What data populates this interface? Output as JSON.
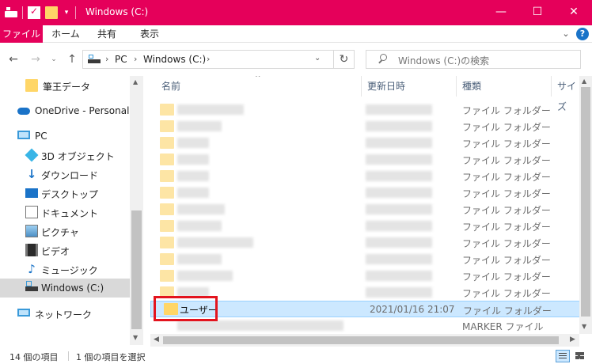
{
  "window": {
    "title": "Windows (C:)",
    "controls": {
      "minimize": "—",
      "maximize": "☐",
      "close": "✕"
    }
  },
  "ribbon": {
    "tabs": [
      "ファイル",
      "ホーム",
      "共有",
      "表示"
    ],
    "expand": "⌄",
    "help": "?"
  },
  "nav": {
    "back": "←",
    "forward": "→",
    "recent": "⌄",
    "up": "↑",
    "breadcrumb": [
      "PC",
      "Windows (C:)"
    ],
    "crumb_sep": "›",
    "address_dropdown": "⌄",
    "refresh": "↻",
    "search_placeholder": "Windows (C:)の検索"
  },
  "sidebar": {
    "items": [
      {
        "label": "筆王データ",
        "icon": "folder-icon"
      },
      {
        "label": "OneDrive - Personal",
        "icon": "cloud-icon"
      },
      {
        "label": "PC",
        "icon": "pc-icon"
      },
      {
        "label": "3D オブジェクト",
        "icon": "3d-objects-icon"
      },
      {
        "label": "ダウンロード",
        "icon": "download-icon"
      },
      {
        "label": "デスクトップ",
        "icon": "desktop-icon"
      },
      {
        "label": "ドキュメント",
        "icon": "document-icon"
      },
      {
        "label": "ピクチャ",
        "icon": "picture-icon"
      },
      {
        "label": "ビデオ",
        "icon": "video-icon"
      },
      {
        "label": "ミュージック",
        "icon": "music-icon"
      },
      {
        "label": "Windows (C:)",
        "icon": "drive-icon",
        "selected": true
      },
      {
        "label": "ネットワーク",
        "icon": "network-icon"
      }
    ]
  },
  "file_list": {
    "columns": [
      "名前",
      "更新日時",
      "種類",
      "サイズ"
    ],
    "sort_indicator": "^",
    "rows": [
      {
        "name": "",
        "date": "",
        "type": "ファイル フォルダー"
      },
      {
        "name": "",
        "date": "",
        "type": "ファイル フォルダー"
      },
      {
        "name": "",
        "date": "",
        "type": "ファイル フォルダー"
      },
      {
        "name": "",
        "date": "",
        "type": "ファイル フォルダー"
      },
      {
        "name": "",
        "date": "",
        "type": "ファイル フォルダー"
      },
      {
        "name": "",
        "date": "",
        "type": "ファイル フォルダー"
      },
      {
        "name": "",
        "date": "",
        "type": "ファイル フォルダー"
      },
      {
        "name": "",
        "date": "",
        "type": "ファイル フォルダー"
      },
      {
        "name": "",
        "date": "",
        "type": "ファイル フォルダー"
      },
      {
        "name": "",
        "date": "",
        "type": "ファイル フォルダー"
      },
      {
        "name": "",
        "date": "",
        "type": "ファイル フォルダー"
      },
      {
        "name": "",
        "date": "",
        "type": "ファイル フォルダー"
      },
      {
        "name": "ユーザー",
        "date": "2021/01/16 21:07",
        "type": "ファイル フォルダー",
        "selected": true
      },
      {
        "name": "",
        "date": "",
        "type": "MARKER ファイル"
      }
    ]
  },
  "status": {
    "item_count": "14 個の項目",
    "selected": "1 個の項目を選択"
  }
}
